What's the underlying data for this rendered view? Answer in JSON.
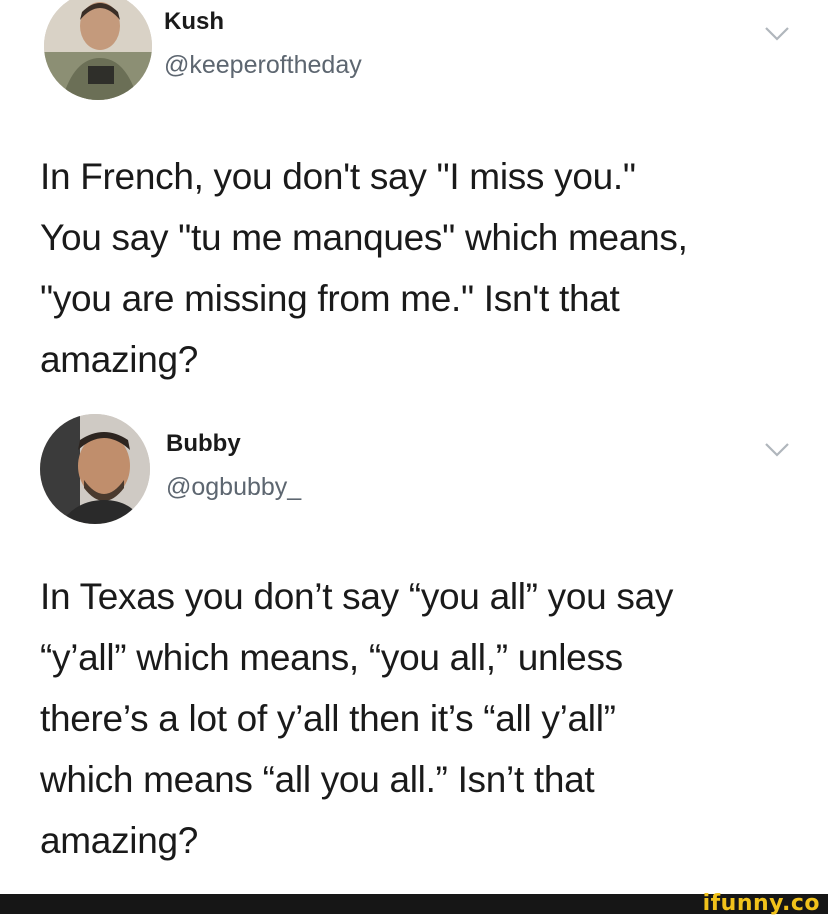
{
  "tweets": [
    {
      "name": "Kush",
      "handle": "@keeperoftheday",
      "lines": [
        "In French, you don't say \"I miss you.\"",
        "You say \"tu me manques\" which means,",
        "\"you are missing from me.\" Isn't that",
        "amazing?"
      ]
    },
    {
      "name": "Bubby",
      "handle": "@ogbubby_",
      "lines": [
        "In Texas you don’t say “you all” you say",
        "“y’all” which means, “you all,” unless",
        "there’s a lot of y’all then it’s “all y’all”",
        "which means “all you all.” Isn’t that",
        "amazing?"
      ]
    }
  ],
  "watermark": "ifunny.co",
  "colors": {
    "text": "#1a1a1a",
    "handle": "#5d6670",
    "chevron": "#b0b6bc",
    "footer": "#161616",
    "watermark": "#f1c21b"
  },
  "icons": {
    "caret": "chevron-down-icon"
  }
}
